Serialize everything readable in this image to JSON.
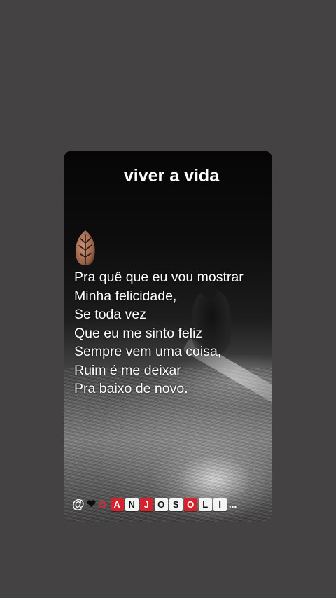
{
  "post": {
    "title": "viver a vida",
    "lyrics": [
      "Pra quê que eu vou mostrar",
      "Minha felicidade,",
      "Se toda vez",
      "Que eu me sinto feliz",
      "Sempre vem uma coisa,",
      "Ruim é me deixar",
      "Pra baixo de novo."
    ],
    "credit": {
      "prefix": "@",
      "letters": [
        "A",
        "N",
        "J",
        "O",
        "S",
        "O",
        "L",
        "I"
      ],
      "ellipsis": "..."
    }
  },
  "icons": [
    "leaf-icon",
    "heart-icon",
    "rose-icon"
  ],
  "colors": {
    "background": "#444243",
    "text": "#ffffff",
    "tile_red": "#d6222c",
    "tile_white": "#f4f4f4"
  }
}
